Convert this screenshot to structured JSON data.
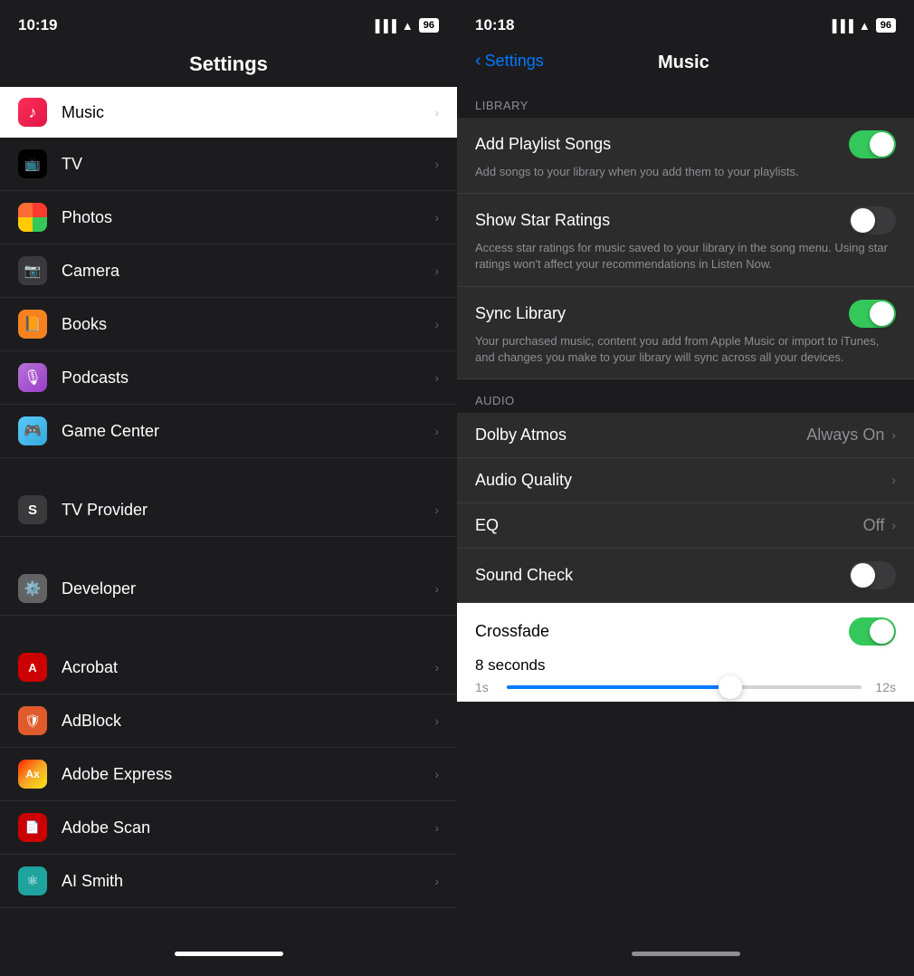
{
  "left": {
    "statusBar": {
      "time": "10:19",
      "battery": "96"
    },
    "title": "Settings",
    "rows": [
      {
        "id": "music",
        "label": "Music",
        "iconType": "music",
        "highlighted": true
      },
      {
        "id": "tv",
        "label": "TV",
        "iconType": "tv"
      },
      {
        "id": "photos",
        "label": "Photos",
        "iconType": "photos"
      },
      {
        "id": "camera",
        "label": "Camera",
        "iconType": "camera"
      },
      {
        "id": "books",
        "label": "Books",
        "iconType": "books"
      },
      {
        "id": "podcasts",
        "label": "Podcasts",
        "iconType": "podcasts"
      },
      {
        "id": "gamecenter",
        "label": "Game Center",
        "iconType": "gamecenter"
      }
    ],
    "rows2": [
      {
        "id": "tvprovider",
        "label": "TV Provider",
        "iconType": "tvprovider"
      }
    ],
    "rows3": [
      {
        "id": "developer",
        "label": "Developer",
        "iconType": "developer"
      }
    ],
    "rows4": [
      {
        "id": "acrobat",
        "label": "Acrobat",
        "iconType": "acrobat"
      },
      {
        "id": "adblock",
        "label": "AdBlock",
        "iconType": "adblock"
      },
      {
        "id": "adobeexpress",
        "label": "Adobe Express",
        "iconType": "adobeexpress"
      },
      {
        "id": "adobescan",
        "label": "Adobe Scan",
        "iconType": "adobescan"
      },
      {
        "id": "asmith",
        "label": "AI Smith",
        "iconType": "asmith"
      }
    ]
  },
  "right": {
    "statusBar": {
      "time": "10:18",
      "battery": "96"
    },
    "backLabel": "Settings",
    "title": "Music",
    "sections": {
      "library": {
        "header": "LIBRARY",
        "items": [
          {
            "id": "add-playlist-songs",
            "label": "Add Playlist Songs",
            "desc": "Add songs to your library when you add them to your playlists.",
            "type": "toggle",
            "value": true
          },
          {
            "id": "show-star-ratings",
            "label": "Show Star Ratings",
            "desc": "Access star ratings for music saved to your library in the song menu. Using star ratings won't affect your recommendations in Listen Now.",
            "type": "toggle",
            "value": false
          },
          {
            "id": "sync-library",
            "label": "Sync Library",
            "desc": "Your purchased music, content you add from Apple Music or import to iTunes, and changes you make to your library will sync across all your devices.",
            "type": "toggle",
            "value": true
          }
        ]
      },
      "audio": {
        "header": "AUDIO",
        "items": [
          {
            "id": "dolby-atmos",
            "label": "Dolby Atmos",
            "value": "Always On",
            "type": "nav"
          },
          {
            "id": "audio-quality",
            "label": "Audio Quality",
            "value": "",
            "type": "nav"
          },
          {
            "id": "eq",
            "label": "EQ",
            "value": "Off",
            "type": "nav"
          },
          {
            "id": "sound-check",
            "label": "Sound Check",
            "value": "",
            "type": "toggle",
            "toggleValue": false
          }
        ]
      }
    },
    "crossfade": {
      "label": "Crossfade",
      "toggleOn": true,
      "secondsLabel": "8 seconds",
      "sliderMin": "1s",
      "sliderMax": "12s",
      "sliderPercent": 63
    }
  }
}
